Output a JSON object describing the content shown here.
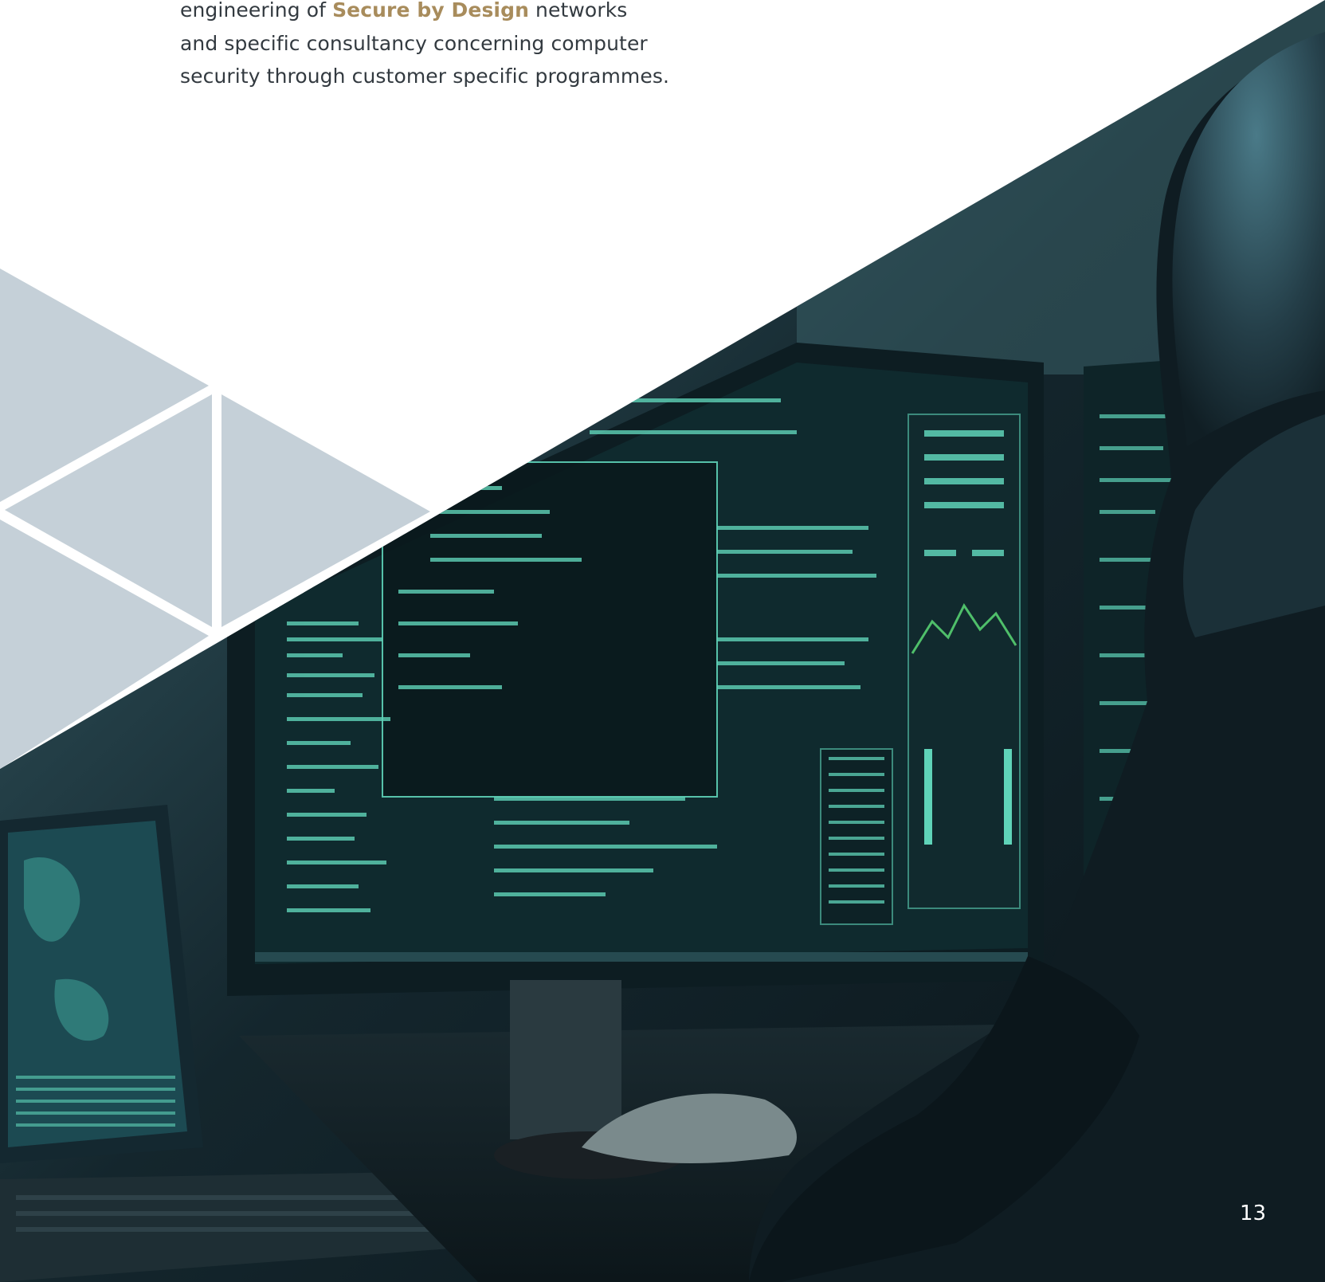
{
  "intro": {
    "line1_before": "engineering of ",
    "line1_emphasis": "Secure by Design",
    "line1_after": " networks",
    "line2": "and specific consultancy concerning computer",
    "line3": "security through customer specific programmes."
  },
  "page_number": "13",
  "colors": {
    "accent": "#a88c5c",
    "body_text": "#333a40",
    "triangle_fill": "#c5d0d8",
    "screen_glow": "#5fd3b8"
  }
}
